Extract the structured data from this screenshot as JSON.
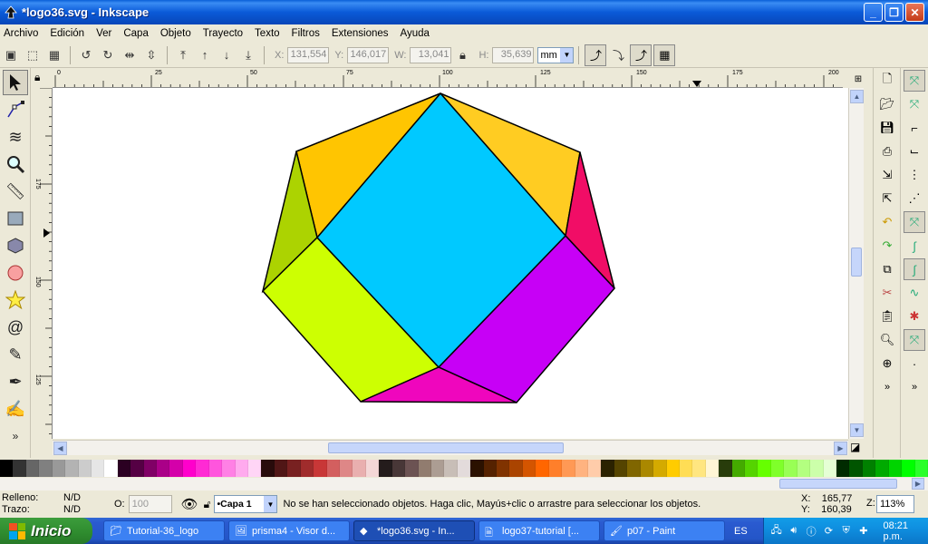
{
  "window": {
    "title": "*logo36.svg - Inkscape"
  },
  "menu": [
    "Archivo",
    "Edición",
    "Ver",
    "Capa",
    "Objeto",
    "Trayecto",
    "Texto",
    "Filtros",
    "Extensiones",
    "Ayuda"
  ],
  "controls": {
    "x_label": "X:",
    "x_value": "131,554",
    "y_label": "Y:",
    "y_value": "146,017",
    "w_label": "W:",
    "w_value": "13,041",
    "h_label": "H:",
    "h_value": "35,639",
    "unit": "mm"
  },
  "rulers": {
    "h_ticks": [
      "0",
      "25",
      "50",
      "75",
      "100",
      "125",
      "150",
      "175",
      "200"
    ],
    "v_ticks": [
      "175",
      "150",
      "125"
    ]
  },
  "shape": {
    "colors": {
      "top_left": "#ffc501",
      "top_right": "#ffcc22",
      "left": "#acd301",
      "right": "#f10d66",
      "bottom_left": "#cdff02",
      "bottom_right": "#c700f6",
      "bottom": "#ef06bd",
      "center": "#00c9ff"
    }
  },
  "palette": [
    "#000000",
    "#333333",
    "#666666",
    "#808080",
    "#999999",
    "#b3b3b3",
    "#cccccc",
    "#e6e6e6",
    "#ffffff",
    "#2b0022",
    "#550044",
    "#800066",
    "#aa0088",
    "#d400aa",
    "#ff00cc",
    "#ff2ad4",
    "#ff55dd",
    "#ff80e5",
    "#ffaaee",
    "#ffd5f6",
    "#280b0b",
    "#501616",
    "#782121",
    "#a02c2c",
    "#c83737",
    "#d35f5f",
    "#de8787",
    "#e9afaf",
    "#f4d7d7",
    "#241c1c",
    "#483737",
    "#6c5353",
    "#917c6f",
    "#ac9d93",
    "#c8beb7",
    "#e3dbdb",
    "#2b1100",
    "#552200",
    "#803300",
    "#aa4400",
    "#d45500",
    "#ff6600",
    "#ff7f2a",
    "#ff9955",
    "#ffb380",
    "#ffccaa",
    "#2b2200",
    "#554400",
    "#806600",
    "#aa8800",
    "#d4aa00",
    "#ffcc00",
    "#ffdd55",
    "#ffe680",
    "#fff6d5",
    "#283c0b",
    "#44aa00",
    "#55d400",
    "#66ff00",
    "#7fff2a",
    "#99ff55",
    "#b3ff80",
    "#ccffaa",
    "#e5ffd5",
    "#002b00",
    "#005500",
    "#008000",
    "#00aa00",
    "#00d400",
    "#00ff00",
    "#2aff2a"
  ],
  "status": {
    "fill_label": "Relleno:",
    "fill_value": "N/D",
    "stroke_label": "Trazo:",
    "stroke_value": "N/D",
    "opacity_label": "O:",
    "opacity_value": "100",
    "layer": "•Capa 1",
    "message": "No se han seleccionado objetos. Haga clic, Mayús+clic o arrastre para seleccionar los objetos.",
    "x_label": "X:",
    "x_value": "165,77",
    "y_label": "Y:",
    "y_value": "160,39",
    "zoom_label": "Z:",
    "zoom_value": "113%"
  },
  "taskbar": {
    "start": "Inicio",
    "tasks": [
      "Tutorial-36_logo",
      "prisma4 - Visor d...",
      "*logo36.svg - In...",
      "logo37-tutorial [...",
      "p07 - Paint"
    ],
    "lang": "ES",
    "clock": "08:21 p.m."
  }
}
